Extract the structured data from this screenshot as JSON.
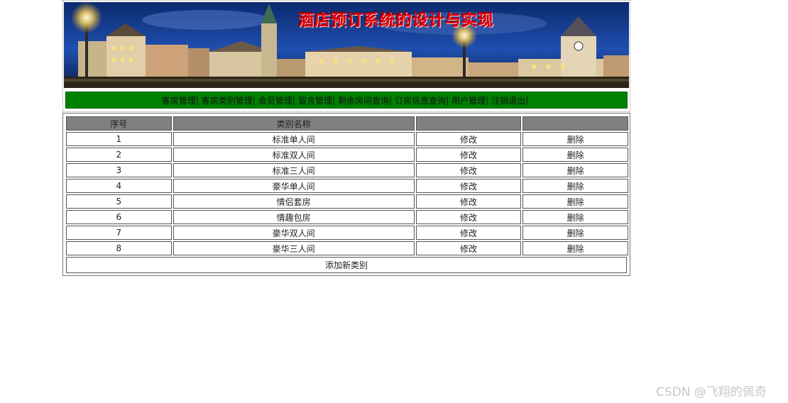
{
  "banner": {
    "title": "酒店预订系统的设计与实现"
  },
  "nav": {
    "items": [
      "客房管理",
      "客房类别管理",
      "会员管理",
      "留言管理",
      "剩余房间查询",
      "订房信息查询",
      "用户管理",
      "注销退出"
    ],
    "separator": "|"
  },
  "table": {
    "headers": [
      "序号",
      "类别名称",
      "",
      ""
    ],
    "rows": [
      {
        "id": "1",
        "name": "标准单人间",
        "edit": "修改",
        "delete": "删除"
      },
      {
        "id": "2",
        "name": "标准双人间",
        "edit": "修改",
        "delete": "删除"
      },
      {
        "id": "3",
        "name": "标准三人间",
        "edit": "修改",
        "delete": "删除"
      },
      {
        "id": "4",
        "name": "豪华单人间",
        "edit": "修改",
        "delete": "删除"
      },
      {
        "id": "5",
        "name": "情侣套房",
        "edit": "修改",
        "delete": "删除"
      },
      {
        "id": "6",
        "name": "情趣包房",
        "edit": "修改",
        "delete": "删除"
      },
      {
        "id": "7",
        "name": "豪华双人间",
        "edit": "修改",
        "delete": "删除"
      },
      {
        "id": "8",
        "name": "豪华三人间",
        "edit": "修改",
        "delete": "删除"
      }
    ],
    "add_label": "添加新类别"
  },
  "watermark": "CSDN @飞翔的佩奇",
  "colors": {
    "nav_bg": "#008000",
    "header_bg": "#808080",
    "title_red": "#e00010"
  }
}
